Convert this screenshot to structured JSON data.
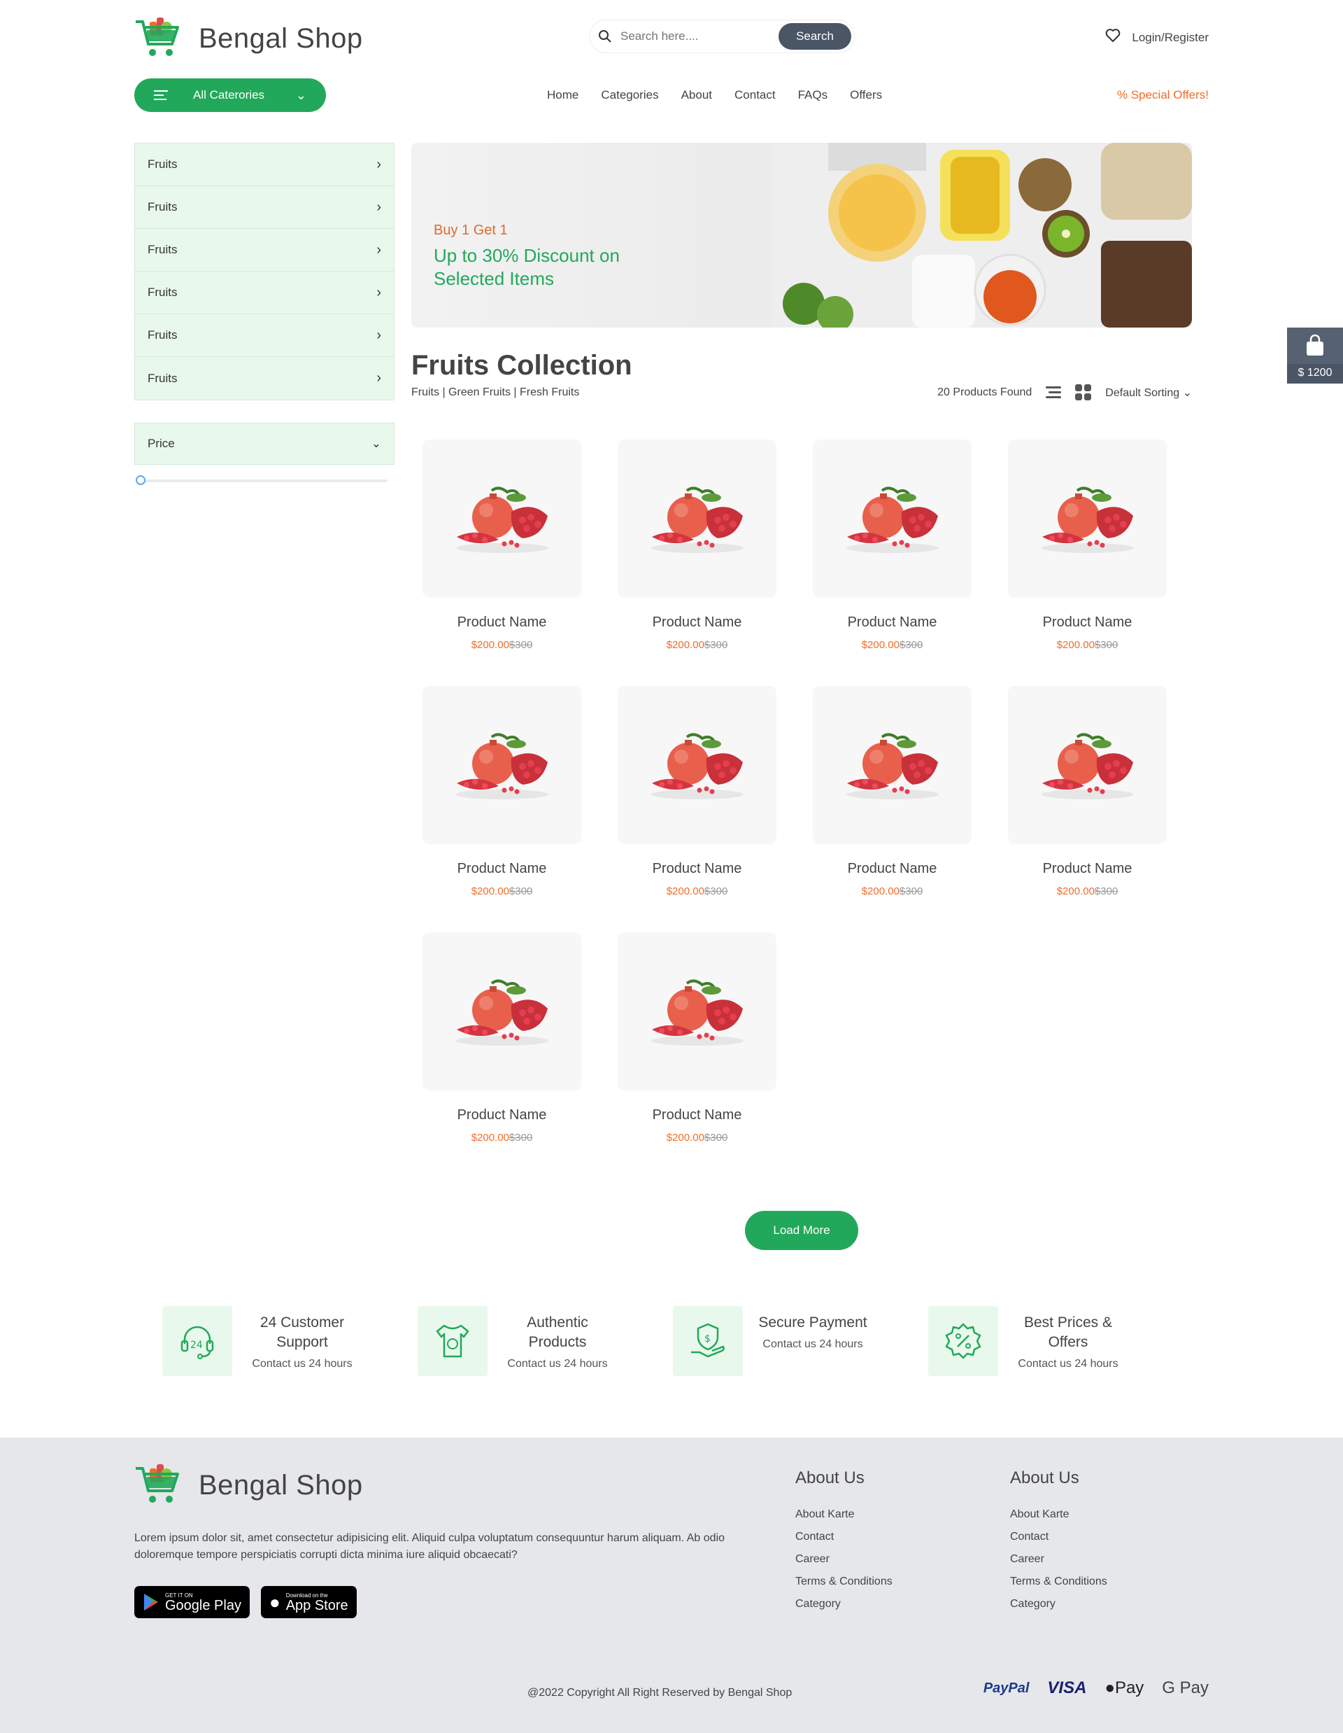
{
  "header": {
    "brand": "Bengal Shop",
    "search_placeholder": "Search here....",
    "search_button": "Search",
    "login": "Login/Register",
    "categories_button": "All Caterories",
    "nav": [
      "Home",
      "Categories",
      "About",
      "Contact",
      "FAQs",
      "Offers"
    ],
    "special": "Special Offers!"
  },
  "sidebar": {
    "categories": [
      "Fruits",
      "Fruits",
      "Fruits",
      "Fruits",
      "Fruits",
      "Fruits"
    ],
    "price_label": "Price"
  },
  "banner": {
    "subtitle": "Buy 1 Get 1",
    "title_line1": "Up to 30% Discount on",
    "title_line2": "Selected Items"
  },
  "collection": {
    "title": "Fruits Collection",
    "breadcrumb": "Fruits | Green Fruits | Fresh Fruits",
    "found": "20 Products Found",
    "sorting": "Default Sorting"
  },
  "products": [
    {
      "name": "Product Name",
      "price": "$200.00",
      "old_price": "$300"
    },
    {
      "name": "Product Name",
      "price": "$200.00",
      "old_price": "$300"
    },
    {
      "name": "Product Name",
      "price": "$200.00",
      "old_price": "$300"
    },
    {
      "name": "Product Name",
      "price": "$200.00",
      "old_price": "$300"
    },
    {
      "name": "Product Name",
      "price": "$200.00",
      "old_price": "$300"
    },
    {
      "name": "Product Name",
      "price": "$200.00",
      "old_price": "$300"
    },
    {
      "name": "Product Name",
      "price": "$200.00",
      "old_price": "$300"
    },
    {
      "name": "Product Name",
      "price": "$200.00",
      "old_price": "$300"
    },
    {
      "name": "Product Name",
      "price": "$200.00",
      "old_price": "$300"
    },
    {
      "name": "Product Name",
      "price": "$200.00",
      "old_price": "$300"
    }
  ],
  "load_more": "Load More",
  "features": [
    {
      "title": "24 Customer Support",
      "sub": "Contact us 24 hours",
      "icon": "headset-24-icon"
    },
    {
      "title": "Authentic Products",
      "sub": "Contact us 24 hours",
      "icon": "shirt-badge-icon"
    },
    {
      "title": "Secure Payment",
      "sub": "Contact us 24 hours",
      "icon": "hand-shield-dollar-icon"
    },
    {
      "title": "Best Prices & Offers",
      "sub": "Contact us 24 hours",
      "icon": "percent-badge-icon"
    }
  ],
  "cart_float": {
    "amount": "$ 1200"
  },
  "footer": {
    "brand": "Bengal Shop",
    "description": "Lorem ipsum dolor sit, amet consectetur adipisicing elit. Aliquid culpa voluptatum consequuntur harum aliquam. Ab odio doloremque tempore perspiciatis corrupti dicta minima iure aliquid obcaecati?",
    "google_small": "GET IT ON",
    "google_big": "Google Play",
    "apple_small": "Download on the",
    "apple_big": "App Store",
    "col1": {
      "title": "About Us",
      "links": [
        "About Karte",
        "Contact",
        "Career",
        "Terms & Conditions",
        "Category"
      ]
    },
    "col2": {
      "title": "About Us",
      "links": [
        "About Karte",
        "Contact",
        "Career",
        "Terms & Conditions",
        "Category"
      ]
    },
    "copyright": "@2022 Copyright All Right Reserved by Bengal Shop",
    "payments": [
      "PayPal",
      "VISA",
      "Pay",
      "G Pay"
    ]
  },
  "colors": {
    "brand_green": "#22a85a",
    "accent_orange": "#f26c29",
    "dark_button": "#4a5565",
    "light_green": "#e9f8ec"
  }
}
